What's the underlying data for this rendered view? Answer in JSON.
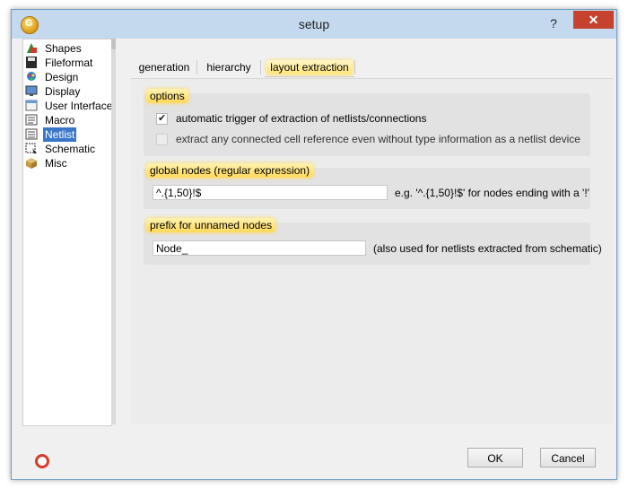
{
  "window": {
    "title": "setup",
    "help_label": "?",
    "close_label": "✕",
    "app_icon_letter": "G"
  },
  "tree": {
    "items": [
      {
        "label": "Shapes",
        "icon": "shapes-icon",
        "selected": false
      },
      {
        "label": "Fileformat",
        "icon": "floppy-disk-icon",
        "selected": false
      },
      {
        "label": "Design",
        "icon": "design-icon",
        "selected": false
      },
      {
        "label": "Display",
        "icon": "display-icon",
        "selected": false
      },
      {
        "label": "User Interface",
        "icon": "user-interface-icon",
        "selected": false
      },
      {
        "label": "Macro",
        "icon": "macro-icon",
        "selected": false
      },
      {
        "label": "Netlist",
        "icon": "netlist-icon",
        "selected": true
      },
      {
        "label": "Schematic",
        "icon": "schematic-icon",
        "selected": false
      },
      {
        "label": "Misc",
        "icon": "box-icon",
        "selected": false
      }
    ]
  },
  "tabs": [
    {
      "label": "generation",
      "active": false
    },
    {
      "label": "hierarchy",
      "active": false
    },
    {
      "label": "layout extraction",
      "active": true
    }
  ],
  "options": {
    "title": "options",
    "auto_trigger": {
      "label": "automatic trigger of extraction of netlists/connections",
      "checked": true
    },
    "extract_any": {
      "label": "extract any connected cell reference even without type information as a netlist device",
      "checked": false,
      "enabled": false
    }
  },
  "global_nodes": {
    "title": "global nodes (regular expression)",
    "value": "^.{1,50}!$",
    "hint": "e.g. '^.{1,50}!$' for nodes ending with a '!'"
  },
  "prefix": {
    "title": "prefix for unnamed nodes",
    "value": "Node_",
    "hint": "(also used for netlists extracted from schematic)"
  },
  "buttons": {
    "ok": "OK",
    "cancel": "Cancel"
  },
  "colors": {
    "titlebar": "#c4d9ee",
    "close": "#c7412f",
    "selection": "#3a76c8",
    "highlight": "#ffd95a"
  }
}
